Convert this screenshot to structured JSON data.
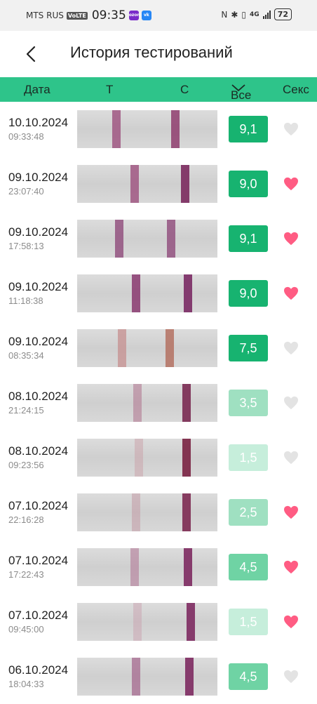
{
  "status": {
    "carrier": "MTS RUS",
    "volte": "VoLTE",
    "time": "09:35",
    "network": "4G",
    "battery": "72"
  },
  "header": {
    "title": "История тестирований"
  },
  "columns": {
    "date": "Дата",
    "t": "Т",
    "c": "С",
    "filter": "Все",
    "sex": "Секс"
  },
  "colors": {
    "accent": "#2ec48a",
    "heart_on": "#ff5c83",
    "heart_off": "#e3e3e3"
  },
  "rows": [
    {
      "date": "10.10.2024",
      "time": "09:33:48",
      "score": "9,1",
      "sex": false
    },
    {
      "date": "09.10.2024",
      "time": "23:07:40",
      "score": "9,0",
      "sex": true
    },
    {
      "date": "09.10.2024",
      "time": "17:58:13",
      "score": "9,1",
      "sex": true
    },
    {
      "date": "09.10.2024",
      "time": "11:18:38",
      "score": "9,0",
      "sex": true
    },
    {
      "date": "09.10.2024",
      "time": "08:35:34",
      "score": "7,5",
      "sex": false
    },
    {
      "date": "08.10.2024",
      "time": "21:24:15",
      "score": "3,5",
      "sex": false
    },
    {
      "date": "08.10.2024",
      "time": "09:23:56",
      "score": "1,5",
      "sex": false
    },
    {
      "date": "07.10.2024",
      "time": "22:16:28",
      "score": "2,5",
      "sex": true
    },
    {
      "date": "07.10.2024",
      "time": "17:22:43",
      "score": "4,5",
      "sex": true
    },
    {
      "date": "07.10.2024",
      "time": "09:45:00",
      "score": "1,5",
      "sex": true
    },
    {
      "date": "06.10.2024",
      "time": "18:04:33",
      "score": "4,5",
      "sex": false
    }
  ]
}
